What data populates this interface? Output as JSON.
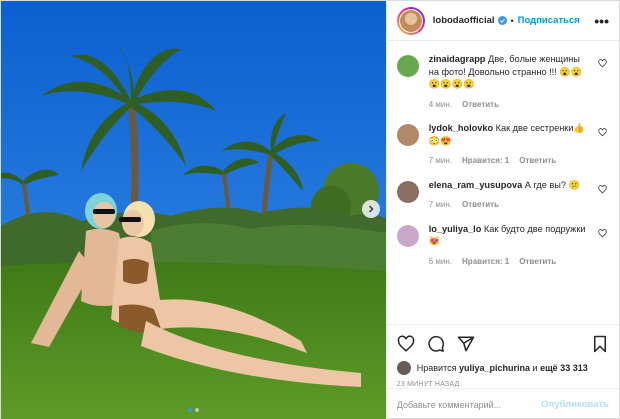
{
  "post": {
    "author": "lobodaofficial",
    "follow_label": "Подписаться",
    "separator": "•",
    "more_label": "•••"
  },
  "colors": {
    "accent": "#0095f6",
    "sky": "#1a6fd6",
    "grass": "#4f8a1d",
    "muted": "#8e8e8e"
  },
  "carousel": {
    "total": 2,
    "active": 1
  },
  "comments": [
    {
      "user": "zinaidagrapp",
      "text": "Две, бoлые женщины на фото! Довольно странно !!! 😮😮😮😮😮😮",
      "time": "4 мин.",
      "likes": "",
      "reply": "Ответить",
      "avatar_color": "#6aa84f"
    },
    {
      "user": "lydok_holovko",
      "text": "Как две сестренки👍😳😍",
      "time": "7 мин.",
      "likes": "Нравится: 1",
      "reply": "Ответить",
      "avatar_color": "#b08968"
    },
    {
      "user": "elena_ram_yusupova",
      "text": "А где вы? 😕",
      "time": "7 мин.",
      "likes": "",
      "reply": "Ответить",
      "avatar_color": "#8d6e63"
    },
    {
      "user": "lo_yuliya_lo",
      "text": "Как будто две подружки 😻",
      "time": "6 мин.",
      "likes": "Нравится: 1",
      "reply": "Ответить",
      "avatar_color": "#c9a9c9"
    }
  ],
  "likes": {
    "prefix": "Нравится",
    "user": "yuliya_pichurina",
    "middle": "и",
    "count": "ещё 33 313"
  },
  "timeago": "23 минут назад",
  "add_comment": {
    "placeholder": "Добавьте комментарий...",
    "publish_label": "Опубликовать"
  },
  "icons": {
    "like": "heart-icon",
    "comment": "comment-icon",
    "share": "share-icon",
    "save": "bookmark-icon",
    "verified": "verified-badge-icon",
    "next": "chevron-right-icon"
  }
}
